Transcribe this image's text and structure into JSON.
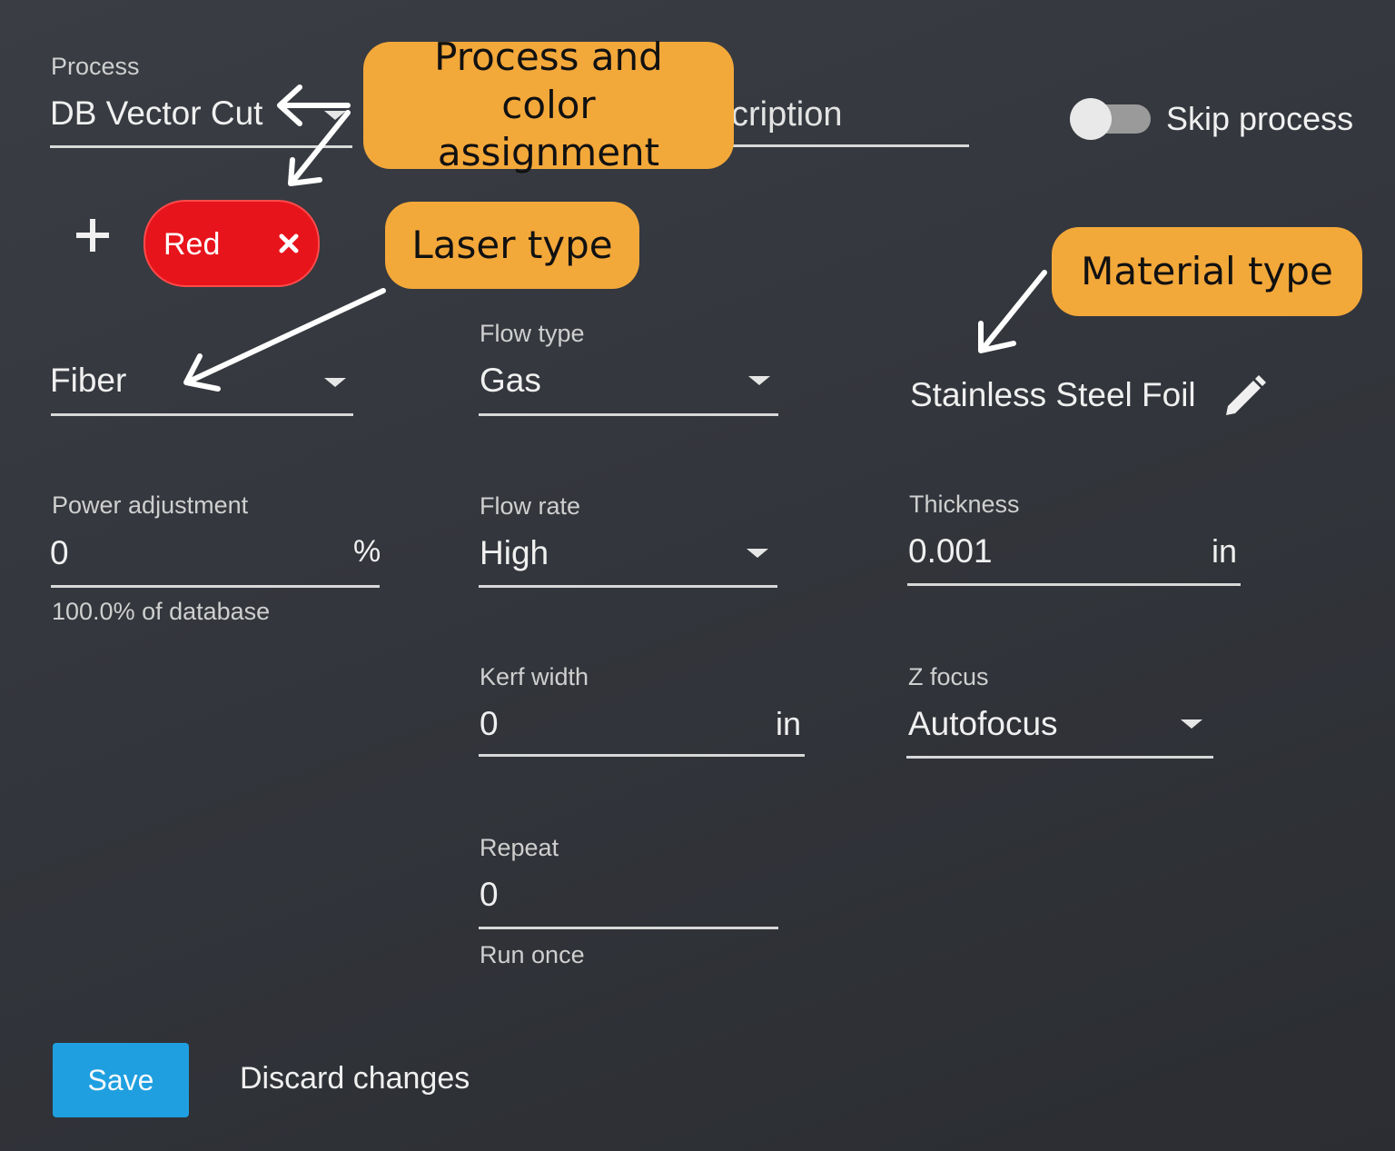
{
  "process": {
    "label": "Process",
    "value": "DB Vector Cut"
  },
  "description": {
    "visible_text": "cription"
  },
  "skip_process": {
    "label": "Skip process",
    "state": "off"
  },
  "color_chip": {
    "label": "Red",
    "color": "#e8141b"
  },
  "laser_type": {
    "value": "Fiber"
  },
  "flow_type": {
    "label": "Flow type",
    "value": "Gas"
  },
  "material": {
    "value": "Stainless Steel Foil"
  },
  "power_adjustment": {
    "label": "Power adjustment",
    "value": "0",
    "unit": "%",
    "helper": "100.0% of database"
  },
  "flow_rate": {
    "label": "Flow rate",
    "value": "High"
  },
  "thickness": {
    "label": "Thickness",
    "value": "0.001",
    "unit": "in"
  },
  "kerf_width": {
    "label": "Kerf width",
    "value": "0",
    "unit": "in"
  },
  "z_focus": {
    "label": "Z focus",
    "value": "Autofocus"
  },
  "repeat": {
    "label": "Repeat",
    "value": "0",
    "helper": "Run once"
  },
  "actions": {
    "save": "Save",
    "discard": "Discard changes"
  },
  "callouts": {
    "process_color": "Process and color assignment",
    "laser_type": "Laser type",
    "material_type": "Material type"
  },
  "colors": {
    "callout": "#f3a83a",
    "save_button": "#1f9fe0",
    "chip": "#e8141b"
  },
  "icons": [
    "plus-icon",
    "close-icon",
    "pencil-icon",
    "chevron-down-icon"
  ]
}
